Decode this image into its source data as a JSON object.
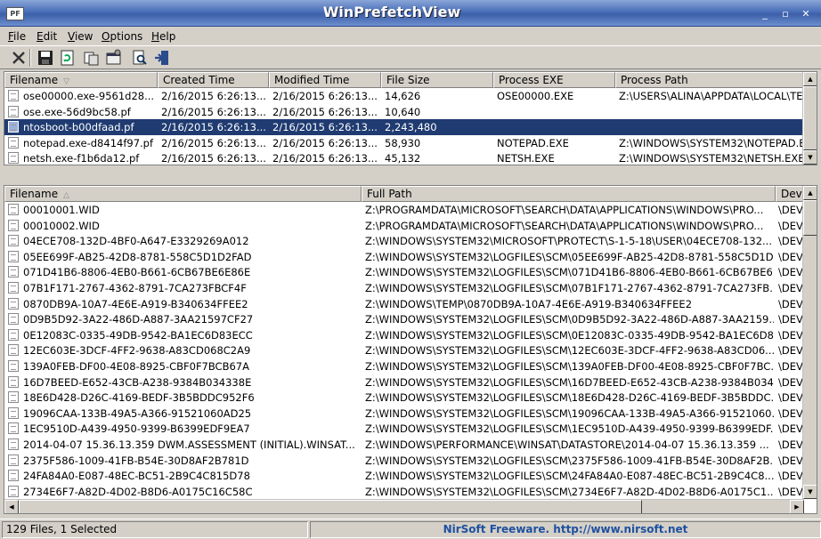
{
  "window": {
    "title": "WinPrefetchView",
    "icon_text": "PF",
    "controls": [
      "_",
      "▫",
      "✕"
    ]
  },
  "menu": [
    {
      "key": "F",
      "rest": "ile"
    },
    {
      "key": "E",
      "rest": "dit"
    },
    {
      "key": "V",
      "rest": "iew"
    },
    {
      "key": "O",
      "rest": "ptions"
    },
    {
      "key": "H",
      "rest": "elp"
    }
  ],
  "toolbar": {
    "icons": [
      "delete-icon",
      "save-icon",
      "refresh-icon",
      "copy-icon",
      "properties-icon",
      "find-icon",
      "exit-icon"
    ]
  },
  "top_table": {
    "columns": [
      "Filename",
      "Created Time",
      "Modified Time",
      "File Size",
      "Process EXE",
      "Process Path"
    ],
    "sort_indicator": "▽",
    "rows": [
      [
        "ose00000.exe-9561d28...",
        "2/16/2015 6:26:13...",
        "2/16/2015 6:26:13...",
        "14,626",
        "OSE00000.EXE",
        "Z:\\USERS\\ALINA\\APPDATA\\LOCAL\\TE"
      ],
      [
        "ose.exe-56d9bc58.pf",
        "2/16/2015 6:26:13...",
        "2/16/2015 6:26:13...",
        "10,640",
        "",
        ""
      ],
      [
        "ntosboot-b00dfaad.pf",
        "2/16/2015 6:26:13...",
        "2/16/2015 6:26:13...",
        "2,243,480",
        "",
        ""
      ],
      [
        "notepad.exe-d8414f97.pf",
        "2/16/2015 6:26:13...",
        "2/16/2015 6:26:13...",
        "58,930",
        "NOTEPAD.EXE",
        "Z:\\WINDOWS\\SYSTEM32\\NOTEPAD.E"
      ],
      [
        "netsh.exe-f1b6da12.pf",
        "2/16/2015 6:26:13...",
        "2/16/2015 6:26:13...",
        "45,132",
        "NETSH.EXE",
        "Z:\\WINDOWS\\SYSTEM32\\NETSH.EXE"
      ]
    ],
    "selected_index": 2
  },
  "bottom_table": {
    "columns": [
      "Filename",
      "Full Path",
      "Devi"
    ],
    "sort_indicator": "△",
    "rows": [
      [
        "00010001.WID",
        "Z:\\PROGRAMDATA\\MICROSOFT\\SEARCH\\DATA\\APPLICATIONS\\WINDOWS\\PRO...",
        "\\DEV"
      ],
      [
        "00010002.WID",
        "Z:\\PROGRAMDATA\\MICROSOFT\\SEARCH\\DATA\\APPLICATIONS\\WINDOWS\\PRO...",
        "\\DEV"
      ],
      [
        "04ECE708-132D-4BF0-A647-E3329269A012",
        "Z:\\WINDOWS\\SYSTEM32\\MICROSOFT\\PROTECT\\S-1-5-18\\USER\\04ECE708-132...",
        "\\DEV"
      ],
      [
        "05EE699F-AB25-42D8-8781-558C5D1D2FAD",
        "Z:\\WINDOWS\\SYSTEM32\\LOGFILES\\SCM\\05EE699F-AB25-42D8-8781-558C5D1D...",
        "\\DEV"
      ],
      [
        "071D41B6-8806-4EB0-B661-6CB67BE6E86E",
        "Z:\\WINDOWS\\SYSTEM32\\LOGFILES\\SCM\\071D41B6-8806-4EB0-B661-6CB67BE6...",
        "\\DEV"
      ],
      [
        "07B1F171-2767-4362-8791-7CA273FBCF4F",
        "Z:\\WINDOWS\\SYSTEM32\\LOGFILES\\SCM\\07B1F171-2767-4362-8791-7CA273FB...",
        "\\DEV"
      ],
      [
        "0870DB9A-10A7-4E6E-A919-B340634FFEE2",
        "Z:\\WINDOWS\\TEMP\\0870DB9A-10A7-4E6E-A919-B340634FFEE2",
        "\\DEV"
      ],
      [
        "0D9B5D92-3A22-486D-A887-3AA21597CF27",
        "Z:\\WINDOWS\\SYSTEM32\\LOGFILES\\SCM\\0D9B5D92-3A22-486D-A887-3AA2159...",
        "\\DEV"
      ],
      [
        "0E12083C-0335-49DB-9542-BA1EC6D83ECC",
        "Z:\\WINDOWS\\SYSTEM32\\LOGFILES\\SCM\\0E12083C-0335-49DB-9542-BA1EC6D8...",
        "\\DEV"
      ],
      [
        "12EC603E-3DCF-4FF2-9638-A83CD068C2A9",
        "Z:\\WINDOWS\\SYSTEM32\\LOGFILES\\SCM\\12EC603E-3DCF-4FF2-9638-A83CD06...",
        "\\DEV"
      ],
      [
        "139A0FEB-DF00-4E08-8925-CBF0F7BCB67A",
        "Z:\\WINDOWS\\SYSTEM32\\LOGFILES\\SCM\\139A0FEB-DF00-4E08-8925-CBF0F7BC...",
        "\\DEV"
      ],
      [
        "16D7BEED-E652-43CB-A238-9384B034338E",
        "Z:\\WINDOWS\\SYSTEM32\\LOGFILES\\SCM\\16D7BEED-E652-43CB-A238-9384B034...",
        "\\DEV"
      ],
      [
        "18E6D428-D26C-4169-BEDF-3B5BDDC952F6",
        "Z:\\WINDOWS\\SYSTEM32\\LOGFILES\\SCM\\18E6D428-D26C-4169-BEDF-3B5BDDC...",
        "\\DEV"
      ],
      [
        "19096CAA-133B-49A5-A366-91521060AD25",
        "Z:\\WINDOWS\\SYSTEM32\\LOGFILES\\SCM\\19096CAA-133B-49A5-A366-91521060...",
        "\\DEV"
      ],
      [
        "1EC9510D-A439-4950-9399-B6399EDF9EA7",
        "Z:\\WINDOWS\\SYSTEM32\\LOGFILES\\SCM\\1EC9510D-A439-4950-9399-B6399EDF...",
        "\\DEV"
      ],
      [
        "2014-04-07 15.36.13.359 DWM.ASSESSMENT (INITIAL).WINSAT...",
        "Z:\\WINDOWS\\PERFORMANCE\\WINSAT\\DATASTORE\\2014-04-07 15.36.13.359 ...",
        "\\DEV"
      ],
      [
        "2375F586-1009-41FB-B54E-30D8AF2B781D",
        "Z:\\WINDOWS\\SYSTEM32\\LOGFILES\\SCM\\2375F586-1009-41FB-B54E-30D8AF2B...",
        "\\DEV"
      ],
      [
        "24FA84A0-E087-48EC-BC51-2B9C4C815D78",
        "Z:\\WINDOWS\\SYSTEM32\\LOGFILES\\SCM\\24FA84A0-E087-48EC-BC51-2B9C4C8...",
        "\\DEV"
      ],
      [
        "2734E6F7-A82D-4D02-B8D6-A0175C16C58C",
        "Z:\\WINDOWS\\SYSTEM32\\LOGFILES\\SCM\\2734E6F7-A82D-4D02-B8D6-A0175C1...",
        "\\DEV"
      ]
    ]
  },
  "status": {
    "count_text": "129 Files, 1 Selected",
    "link_text": "NirSoft Freeware.  http://www.nirsoft.net"
  },
  "colors": {
    "selection": "#1f3b71",
    "title_bar": "#4a6fb8",
    "link": "#1e50a0"
  }
}
